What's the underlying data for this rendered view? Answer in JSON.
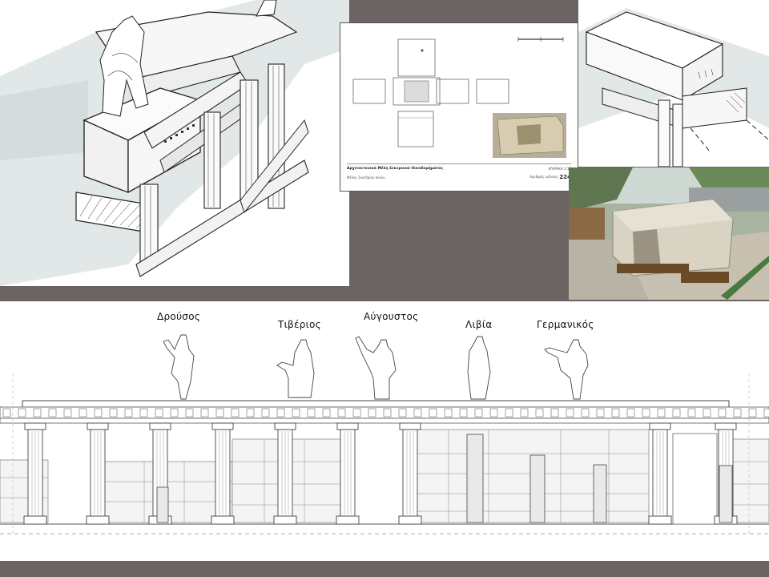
{
  "figures": [
    {
      "key": "drusus",
      "label": "Δρούσος"
    },
    {
      "key": "tiberius",
      "label": "Τιβέριος"
    },
    {
      "key": "augustus",
      "label": "Αύγουστος"
    },
    {
      "key": "livia",
      "label": "Λιβία"
    },
    {
      "key": "germanicus",
      "label": "Γερμανικός"
    }
  ],
  "sheet": {
    "title": "Αρχιτεκτονικά Μέλη Σεκερικού Οικοδομήματος",
    "subtitle": "Μέλος Συνεδρίου Ιονίου",
    "scale_label": "ΚΛΙΜΑΚΑ 1:10",
    "number_label": "Αριθμός μέλους",
    "number": "224"
  },
  "colors": {
    "background": "#6b6463",
    "paper": "#ffffff",
    "ink": "#222222",
    "sky_wash": "#dfe6e6",
    "stone": "#c9c4b6",
    "photo_ground": "#b9b3a6"
  }
}
